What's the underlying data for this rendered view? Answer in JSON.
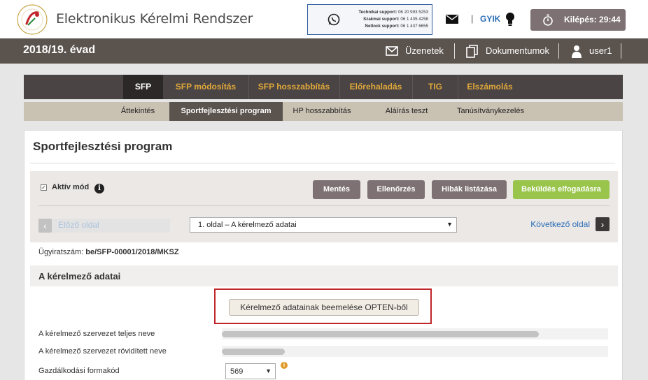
{
  "header": {
    "app_title": "Elektronikus Kérelmi Rendszer",
    "support": [
      {
        "label": "Technikai support:",
        "value": "06 20 993 5253"
      },
      {
        "label": "Szakmai support:",
        "value": "06 1 435 4258"
      },
      {
        "label": "Netlock support:",
        "value": "06 1 437 6655"
      }
    ],
    "gyik_label": "GYIK",
    "logout_label": "Kilépés: 29:44"
  },
  "season_bar": {
    "season": "2018/19. évad",
    "messages_label": "Üzenetek",
    "documents_label": "Dokumentumok",
    "user_label": "user1"
  },
  "main_tabs": [
    {
      "label": "SFP",
      "active": true
    },
    {
      "label": "SFP módosítás",
      "active": false
    },
    {
      "label": "SFP hosszabbítás",
      "active": false
    },
    {
      "label": "Előrehaladás",
      "active": false
    },
    {
      "label": "TIG",
      "active": false
    },
    {
      "label": "Elszámolás",
      "active": false
    }
  ],
  "sub_tabs": [
    {
      "label": "Áttekintés",
      "active": false
    },
    {
      "label": "Sportfejlesztési program",
      "active": true
    },
    {
      "label": "HP hosszabbítás",
      "active": false
    },
    {
      "label": "Aláírás teszt",
      "active": false
    },
    {
      "label": "Tanúsítványkezelés",
      "active": false
    }
  ],
  "panel": {
    "title": "Sportfejlesztési program",
    "aktiv_mode_label": "Aktív mód",
    "aktiv_mode_checked": true,
    "buttons": {
      "save": "Mentés",
      "check": "Ellenőrzés",
      "list_errors": "Hibák listázása",
      "submit": "Beküldés elfogadásra"
    },
    "prev_page_label": "Előző oldal",
    "page_select_value": "1. oldal – A kérelmező adatai",
    "next_page_label": "Következő oldal",
    "case_number_label": "Ügyiratszám:",
    "case_number_value": "be/SFP-00001/2018/MKSZ",
    "section_title": "A kérelmező adatai",
    "opten_button_label": "Kérelmező adatainak beemelése OPTEN-ből",
    "fields": {
      "full_name_label": "A kérelmező szervezet teljes neve",
      "short_name_label": "A kérelmező szervezet rövidített neve",
      "economic_form_label": "Gazdálkodási formakód",
      "economic_form_value": "569"
    }
  },
  "colors": {
    "header_bar": "#5a534e",
    "tab_accent": "#e0a83a",
    "submit_green": "#9ac54c",
    "highlight_red": "#c0262a",
    "link_blue": "#2a6db5"
  }
}
